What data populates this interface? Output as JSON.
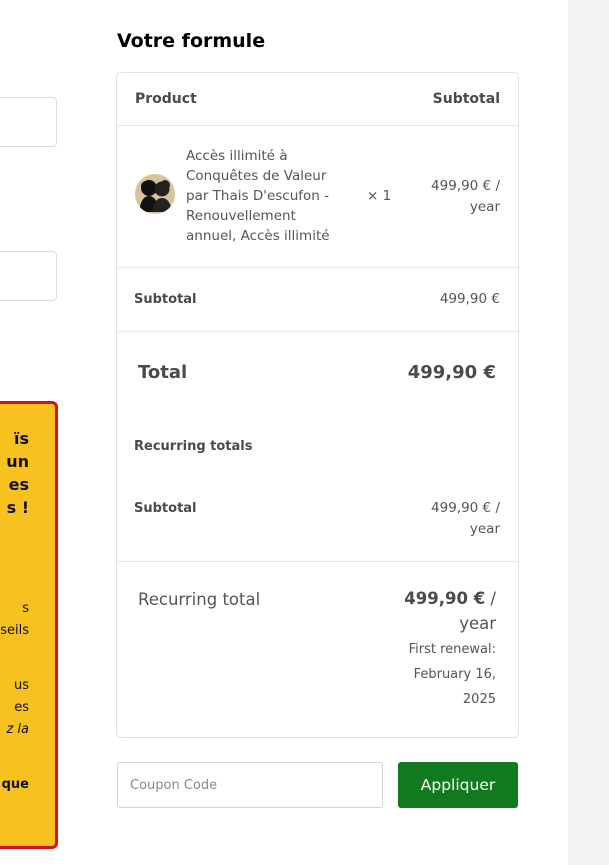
{
  "checkout": {
    "section_title": "Votre formule",
    "table_headers": {
      "product": "Product",
      "subtotal": "Subtotal"
    },
    "line_item": {
      "name_lines": [
        "Accès illimité à",
        "Conquêtes de Valeur",
        "par Thais D'escufon -",
        "Renouvellement",
        "annuel, Accès illimité"
      ],
      "quantity": "× 1",
      "price_lines": [
        "499,90 € /",
        "year"
      ]
    },
    "subtotal": {
      "label": "Subtotal",
      "value": "499,90 €"
    },
    "total": {
      "label": "Total",
      "value": "499,90 €"
    },
    "recurring": {
      "heading": "Recurring totals",
      "subtotal_label": "Subtotal",
      "subtotal_lines": [
        "499,90 € /",
        "year"
      ],
      "total_label": "Recurring total",
      "total_amount": "499,90 €",
      "total_sep": " /",
      "total_period": "year",
      "renewal_lines": [
        "First renewal:",
        "February 16,",
        "2025"
      ]
    }
  },
  "coupon": {
    "placeholder": "Coupon Code",
    "button_label": "Appliquer"
  },
  "promo": {
    "lines": [
      "ïs",
      "un",
      "es",
      "s !",
      "s",
      "seils",
      "us",
      "es",
      "z la",
      "que"
    ]
  }
}
